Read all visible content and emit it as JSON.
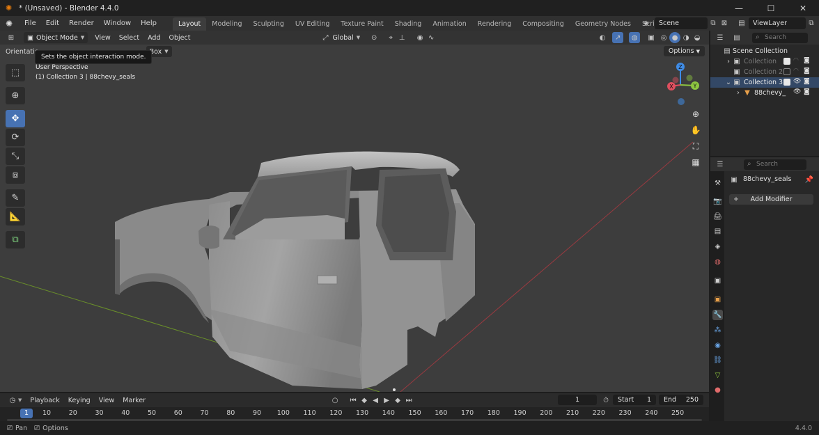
{
  "window": {
    "title": "* (Unsaved) - Blender 4.4.0",
    "minimize": "—",
    "maximize": "☐",
    "close": "✕"
  },
  "menu": {
    "items": [
      "File",
      "Edit",
      "Render",
      "Window",
      "Help"
    ]
  },
  "workspaces": {
    "tabs": [
      "Layout",
      "Modeling",
      "Sculpting",
      "UV Editing",
      "Texture Paint",
      "Shading",
      "Animation",
      "Rendering",
      "Compositing",
      "Geometry Nodes",
      "Scripting"
    ],
    "active": "Layout",
    "add": "+"
  },
  "scene": {
    "name": "Scene"
  },
  "view_layer": {
    "name": "ViewLayer"
  },
  "viewport": {
    "mode": "Object Mode",
    "menus": [
      "View",
      "Select",
      "Add",
      "Object"
    ],
    "transform_orientation": "Global",
    "orientation_label": "Orientatio",
    "drag_value": "Box",
    "tooltip": "Sets the object interaction mode.",
    "perspective": "User Perspective",
    "collection_info": "(1) Collection 3 | 88chevy_seals",
    "options": "Options",
    "axes": {
      "x": "X",
      "y": "Y",
      "z": "Z"
    }
  },
  "timeline": {
    "menus": [
      "Playback",
      "Keying",
      "View",
      "Marker"
    ],
    "current_frame": "1",
    "start_label": "Start",
    "start": "1",
    "end_label": "End",
    "end": "250",
    "ruler": [
      "10",
      "20",
      "30",
      "40",
      "50",
      "60",
      "70",
      "80",
      "90",
      "100",
      "110",
      "120",
      "130",
      "140",
      "150",
      "160",
      "170",
      "180",
      "190",
      "200",
      "210",
      "220",
      "230",
      "240",
      "250"
    ],
    "ruler_current": "1"
  },
  "status": {
    "pan": "Pan",
    "options": "Options",
    "version": "4.4.0"
  },
  "outliner": {
    "search_placeholder": "Search",
    "root": "Scene Collection",
    "rows": [
      {
        "label": "Collection",
        "checked": true,
        "dim": true
      },
      {
        "label": "Collection 2",
        "checked": false,
        "dim": true
      },
      {
        "label": "Collection 3",
        "checked": true,
        "dim": false
      },
      {
        "label": "88chevy_",
        "checked": null,
        "dim": false
      }
    ]
  },
  "properties": {
    "search_placeholder": "Search",
    "object_name": "88chevy_seals",
    "add_modifier": "Add Modifier",
    "add_modifier_plus": "+"
  },
  "colors": {
    "accent": "#4772b3",
    "axis_x": "#e04f5f",
    "axis_y": "#8dc540",
    "axis_z": "#3f8ce6",
    "floor_x_line": "#9a3a40",
    "floor_y_line": "#6a8f2a"
  }
}
